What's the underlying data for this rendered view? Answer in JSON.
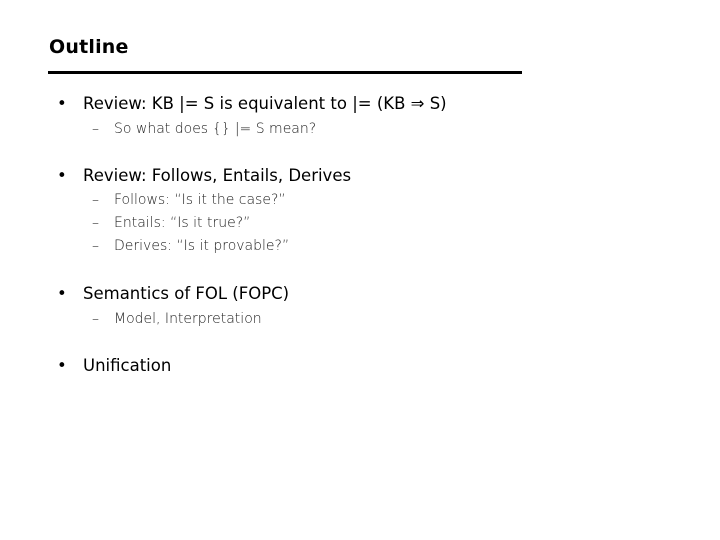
{
  "slide": {
    "title": "Outline",
    "bullets": [
      {
        "text": "Review:  KB |= S  is equivalent to  |= (KB ⇒ S)",
        "subs": [
          "So what does {} |= S  mean?"
        ]
      },
      {
        "text": "Review:  Follows, Entails, Derives",
        "subs": [
          "Follows:  “Is it the case?”",
          "Entails: “Is it true?”",
          "Derives: “Is it provable?”"
        ]
      },
      {
        "text": "Semantics of FOL (FOPC)",
        "subs": [
          "Model, Interpretation"
        ]
      },
      {
        "text": "Unification",
        "subs": []
      }
    ],
    "bullet_glyph": "•",
    "dash_glyph": "–"
  }
}
